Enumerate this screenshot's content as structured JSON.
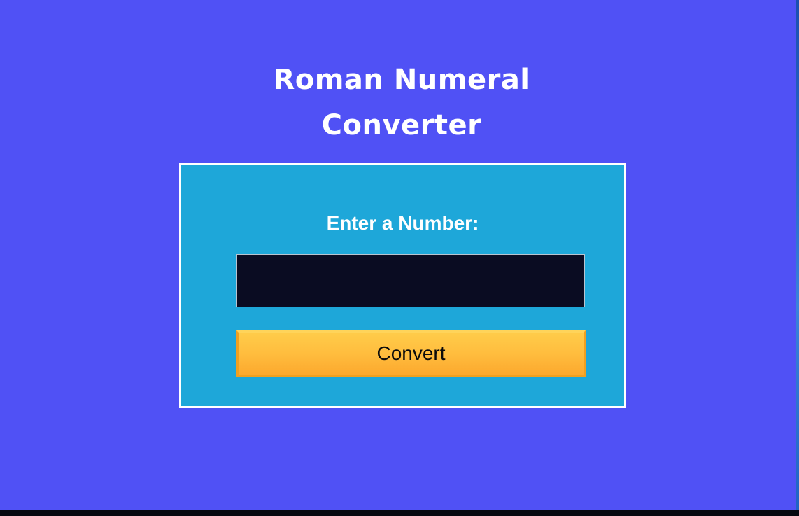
{
  "app": {
    "title_line1": "Roman Numeral",
    "title_line2": "Converter"
  },
  "form": {
    "label": "Enter a Number:",
    "input_value": "",
    "input_placeholder": "",
    "button_label": "Convert"
  },
  "colors": {
    "background": "#5051f5",
    "card": "#1ea7d9",
    "card_border": "#ffffff",
    "input_background": "#0a0c22",
    "button": "#ffbd3e"
  }
}
